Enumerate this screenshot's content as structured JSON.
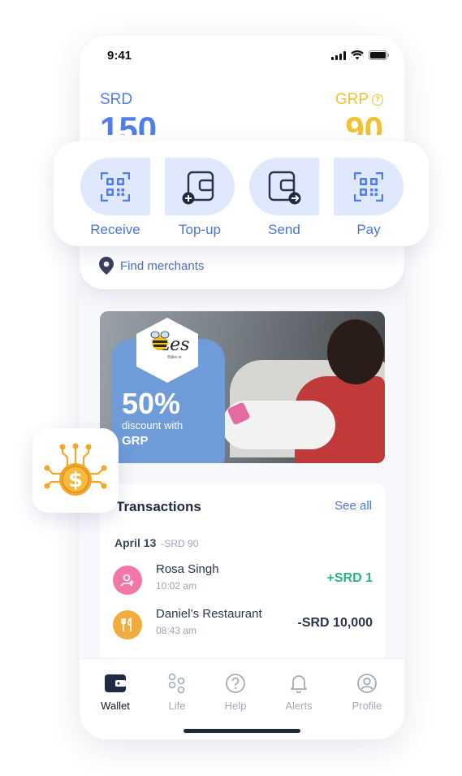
{
  "status_bar": {
    "time": "9:41"
  },
  "balances": {
    "srd": {
      "currency": "SRD",
      "amount": "150"
    },
    "grp": {
      "currency": "GRP",
      "amount": "90",
      "help": "?"
    }
  },
  "actions": [
    {
      "label": "Receive",
      "icon": "qr-code-icon"
    },
    {
      "label": "Top-up",
      "icon": "wallet-plus-icon"
    },
    {
      "label": "Send",
      "icon": "wallet-send-icon"
    },
    {
      "label": "Pay",
      "icon": "qr-code-icon"
    }
  ],
  "find_merchants": {
    "label": "Find merchants",
    "icon": "location-pin-icon"
  },
  "promo": {
    "logo_text": "Les",
    "logo_sub": "Bijles.sr",
    "percent": "50%",
    "line1": "discount with",
    "line2": "GRP"
  },
  "transactions": {
    "title": "Transactions",
    "see_all": "See all",
    "date": "April 13",
    "date_sub": "-SRD  90",
    "items": [
      {
        "name": "Rosa Singh",
        "time": "10:02 am",
        "amount": "+SRD  1",
        "icon": "person-add-icon",
        "color": "#f177a6"
      },
      {
        "name": "Daniel’s Restaurant",
        "time": "08:43 am",
        "amount": "-SRD  10,000",
        "icon": "fork-knife-icon",
        "color": "#f0ac3c"
      }
    ]
  },
  "tabs": [
    {
      "label": "Wallet",
      "icon": "wallet-icon",
      "active": true
    },
    {
      "label": "Life",
      "icon": "life-icon",
      "active": false
    },
    {
      "label": "Help",
      "icon": "question-icon",
      "active": false
    },
    {
      "label": "Alerts",
      "icon": "bell-icon",
      "active": false
    },
    {
      "label": "Profile",
      "icon": "profile-icon",
      "active": false
    }
  ],
  "colors": {
    "primary": "#4f7ee8",
    "grp": "#f2c12e",
    "positive": "#27b783",
    "action_bg": "#dfe8fc"
  },
  "floating_badge": {
    "icon": "coin-circuit-icon",
    "symbol": "$"
  }
}
